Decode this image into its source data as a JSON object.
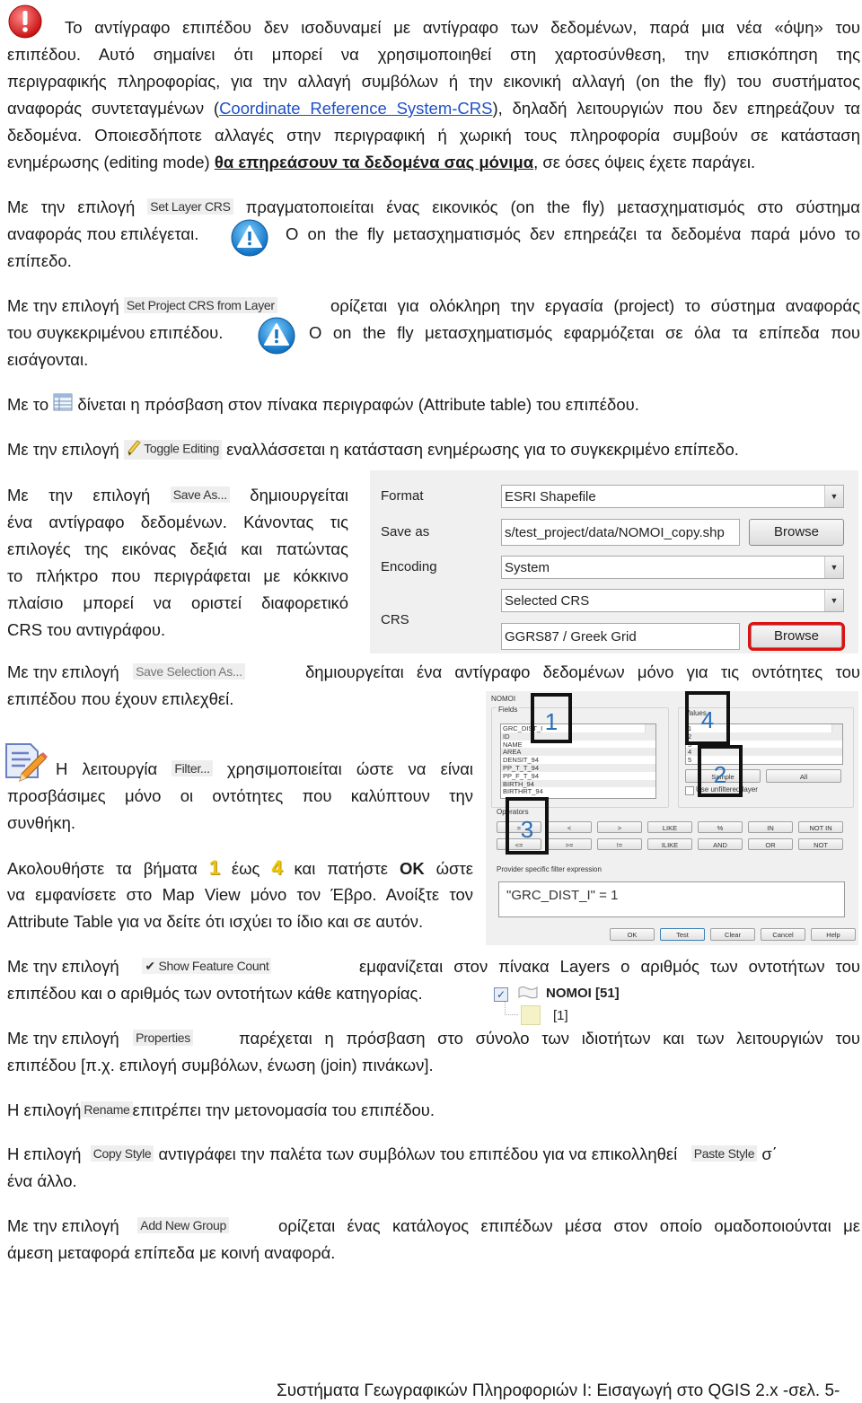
{
  "intro": {
    "icon": "red-exclamation-icon",
    "line1": "Το αντίγραφο επιπέδου δεν ισοδυναμεί με αντίγραφο των δεδομένων, παρά μια νέα «όψη» του",
    "line2": "επιπέδου. Αυτό σημαίνει ότι μπορεί να  χρησιμοποιηθεί στη χαρτοσύνθεση, την επισκόπηση της",
    "line3": "περιγραφικής πληροφορίας, για την αλλαγή συμβόλων ή την εικονική αλλαγή (on the fly) του συστήματος",
    "line4_pre": "αναφοράς συντεταγμένων (",
    "line4_link": "Coordinate Reference System-CRS",
    "line4_post": "), δηλαδή λειτουργιών που δεν επηρεάζουν τα",
    "line5": "δεδομένα. Οποιεσδήποτε αλλαγές στην περιγραφική ή χωρική τους πληροφορία συμβούν σε κατάσταση",
    "line6_pre": "ενημέρωσης (editing mode) ",
    "line6_bold": "θα επηρεάσουν τα δεδομένα σας μόνιμα",
    "line6_post": ", σε όσες όψεις έχετε παράγει."
  },
  "set_layer_crs": {
    "pre": "Με την επιλογή",
    "ui_label": "Set Layer CRS",
    "line1_post": "πραγματοποιείται ένας εικονικός (on the fly) μετασχηματισμός στο σύστημα",
    "line2_pre": "αναφοράς που επιλέγεται.",
    "line2_post": "Ο on the fly μετασχηματισμός δεν επηρεάζει τα δεδομένα παρά μόνο το",
    "line3": "επίπεδο."
  },
  "set_project_crs": {
    "pre": "Με την επιλογή",
    "ui_label": "Set Project CRS from Layer",
    "line1_post": "ορίζεται για ολόκληρη την εργασία (project) το σύστημα αναφοράς",
    "line2_pre": "του συγκεκριμένου επιπέδου.",
    "line2_post": "Ο on the fly μετασχηματισμός εφαρμόζεται σε όλα τα επίπεδα που",
    "line3": "εισάγονται."
  },
  "attribute_table": {
    "pre": "Με το",
    "post": "δίνεται η πρόσβαση στον πίνακα περιγραφών (Attribute table) του επιπέδου."
  },
  "toggle_editing": {
    "pre": "Με την επιλογή",
    "ui_label": "Toggle Editing",
    "post": "εναλλάσσεται η κατάσταση ενημέρωσης για το συγκεκριμένο επίπεδο."
  },
  "save_as": {
    "pre": "Με την επιλογή",
    "ui_label": "Save As...",
    "line1_post": "δημιουργείται",
    "line2": "ένα αντίγραφο δεδομένων. Κάνοντας τις",
    "line3": "επιλογές της εικόνας δεξιά και πατώντας",
    "line4": "το πλήκτρο που περιγράφεται με κόκκινο",
    "line5": "πλαίσιο μπορεί να οριστεί διαφορετικό",
    "line6": "CRS του αντιγράφου."
  },
  "save_dialog": {
    "format_label": "Format",
    "format_value": "ESRI Shapefile",
    "save_as_label": "Save as",
    "save_as_value": "s/test_project/data/NOMOI_copy.shp",
    "browse_label": "Browse",
    "encoding_label": "Encoding",
    "encoding_value": "System",
    "crs_label": "CRS",
    "crs_mode_value": "Selected CRS",
    "crs_value": "GGRS87 / Greek Grid",
    "crs_browse_label": "Browse",
    "highlight_color": "#e01010"
  },
  "save_selection": {
    "pre": "Με την επιλογή",
    "ui_label": "Save Selection As...",
    "line1_post": "δημιουργείται ένα αντίγραφο δεδομένων μόνο για τις οντότητες του",
    "line2": "επιπέδου που έχουν επιλεχθεί."
  },
  "filter": {
    "pre": "Η λειτουργία",
    "ui_label": "Filter...",
    "line1_post": "χρησιμοποιείται ώστε να είναι",
    "line2": "προσβάσιμες μόνο οι οντότητες που καλύπτουν την",
    "line3": "συνθήκη."
  },
  "steps": {
    "line1_pre": "Ακολουθήστε τα βήματα",
    "step_from": "1",
    "mid": "έως",
    "step_to": "4",
    "line1_post_pre": "και πατήστε",
    "ok": "ΟΚ",
    "line1_post": "ώστε",
    "line2": "να εμφανίσετε στο Map View μόνο τον Έβρο. Ανοίξτε τον",
    "line3": "Attribute Table για να δείτε ότι ισχύει το ίδιο και σε αυτόν."
  },
  "filter_dialog": {
    "layer_name": "NOMOI",
    "fields_label": "Fields",
    "fields": [
      "GRC_DIST_I",
      "ID",
      "NAME",
      "AREA",
      "DENSIT_94",
      "PP_T_T_94",
      "PP_F_T_94",
      "BIRTH_94",
      "BIRTHRT_94"
    ],
    "values_label": "Values",
    "values": [
      "1",
      "2",
      "3",
      "4",
      "5"
    ],
    "sample_label": "Sample",
    "all_label": "All",
    "unfiltered_label": "Use unfiltered layer",
    "operators_label": "Operators",
    "operators_row1": [
      "=",
      "<",
      ">",
      "LIKE",
      "%",
      "IN",
      "NOT IN"
    ],
    "operators_row2": [
      "<=",
      ">=",
      "!=",
      "ILIKE",
      "AND",
      "OR",
      "NOT"
    ],
    "expression_label": "Provider specific filter expression",
    "expression": "\"GRC_DIST_I\" = 1",
    "buttons": [
      "OK",
      "Test",
      "Clear",
      "Cancel",
      "Help"
    ],
    "markers": [
      "1",
      "2",
      "3",
      "4"
    ]
  },
  "feature_count": {
    "pre": "Με την  επιλογή",
    "ui_label": "Show Feature Count",
    "line1_post": "εμφανίζεται στον πίνακα Layers ο αριθμός των οντοτήτων του",
    "line2": "επιπέδου και ο αριθμός των οντοτήτων κάθε κατηγορίας.",
    "legend_layer": "ΝΟΜΟΙ [51]",
    "legend_class": "[1]"
  },
  "properties": {
    "pre": "Με την επιλογή",
    "ui_label": "Properties",
    "line1_post": "παρέχεται η πρόσβαση στο σύνολο των ιδιοτήτων και των λειτουργιών του",
    "line2": "επιπέδου [π.χ. επιλογή συμβόλων, ένωση (join) πινάκων]."
  },
  "rename": {
    "pre": "Η επιλογή",
    "ui_label": "Rename",
    "post": "επιτρέπει την μετονομασία του επιπέδου."
  },
  "copy_style": {
    "pre": "Η επιλογή",
    "ui_label": "Copy Style",
    "mid": "αντιγράφει την παλέτα των συμβόλων του επιπέδου  για  να επικολληθεί",
    "ui_label2": "Paste Style",
    "post": "σ΄",
    "line2": "ένα άλλο."
  },
  "add_group": {
    "pre": "Με την επιλογή",
    "ui_label": "Add New Group",
    "line1_post": "ορίζεται ένας κατάλογος επιπέδων μέσα στον οποίο ομαδοποιούνται με",
    "line2": "άμεση μεταφορά επίπεδα με κοινή αναφορά."
  },
  "footer": {
    "text": "Συστήματα Γεωγραφικών Πληροφοριών Ι: Εισαγωγή στο QGIS 2.x   -σελ. 5-"
  }
}
